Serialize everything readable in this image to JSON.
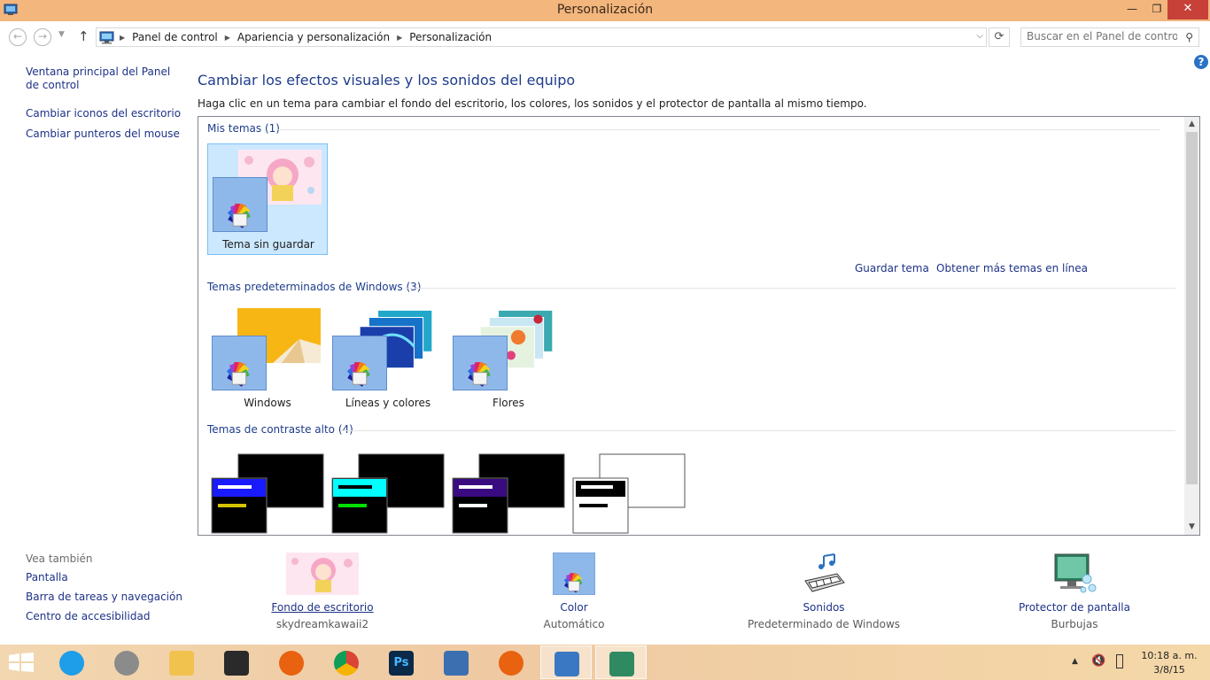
{
  "window": {
    "title": "Personalización",
    "controls": {
      "minimize": "—",
      "maximize": "❐",
      "close": "✕"
    }
  },
  "navigation": {
    "breadcrumbs": [
      "Panel de control",
      "Apariencia y personalización",
      "Personalización"
    ],
    "search_placeholder": "Buscar en el Panel de control"
  },
  "left_pane": {
    "home_link": "Ventana principal del Panel de control",
    "links": [
      "Cambiar iconos del escritorio",
      "Cambiar punteros del mouse"
    ]
  },
  "main": {
    "heading": "Cambiar los efectos visuales y los sonidos del equipo",
    "description": "Haga clic en un tema para cambiar el fondo del escritorio, los colores, los sonidos y el protector de pantalla al mismo tiempo."
  },
  "themes": {
    "my_themes": {
      "title": "Mis temas (1)",
      "items": [
        {
          "label": "Tema sin guardar",
          "selected": true
        }
      ]
    },
    "actions": {
      "save": "Guardar tema",
      "get_more": "Obtener más temas en línea"
    },
    "default_themes": {
      "title": "Temas predeterminados de Windows (3)",
      "items": [
        {
          "label": "Windows"
        },
        {
          "label": "Líneas y colores"
        },
        {
          "label": "Flores"
        }
      ]
    },
    "high_contrast": {
      "title": "Temas de contraste alto (4)",
      "items": [
        {
          "accent": "#1a1aff",
          "line": "#d4c400"
        },
        {
          "accent": "#00ffff",
          "line": "#00e000"
        },
        {
          "accent": "#3a0a80",
          "line": "#ffffff"
        },
        {
          "accent": "#000000",
          "line": "#000000",
          "light": true
        }
      ]
    }
  },
  "see_also": {
    "header": "Vea también",
    "links": [
      "Pantalla",
      "Barra de tareas y navegación",
      "Centro de accesibilidad"
    ]
  },
  "bottom": {
    "desktop_background": {
      "name": "Fondo de escritorio",
      "value": "skydreamkawaii2"
    },
    "color": {
      "name": "Color",
      "value": "Automático"
    },
    "sounds": {
      "name": "Sonidos",
      "value": "Predeterminado de Windows"
    },
    "screen_saver": {
      "name": "Protector de pantalla",
      "value": "Burbujas"
    }
  },
  "taskbar": {
    "time": "10:18 a. m.",
    "date": "3/8/15",
    "apps": [
      "internet-explorer-icon",
      "app-icon",
      "file-explorer-icon",
      "video-studio-icon",
      "firefox-icon",
      "chrome-icon",
      "photoshop-icon",
      "keyboard-icon",
      "firefox-icon",
      "control-panel-icon",
      "personalization-icon"
    ],
    "photoshop_label": "Ps"
  }
}
